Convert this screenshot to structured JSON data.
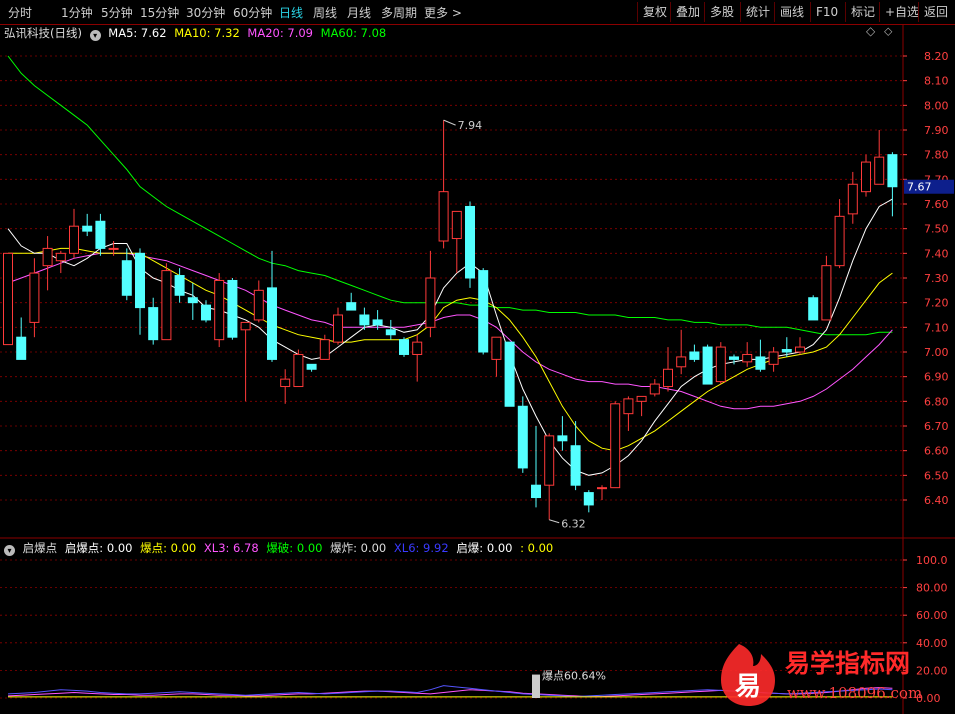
{
  "toolbar": {
    "periods": [
      "分时",
      "1分钟",
      "5分钟",
      "15分钟",
      "30分钟",
      "60分钟",
      "日线",
      "周线",
      "月线",
      "多周期",
      "更多"
    ],
    "active": "日线",
    "more_arrow": ">",
    "right_buttons": [
      "复权",
      "叠加",
      "多股",
      "统计",
      "画线",
      "F10",
      "标记",
      "+自选",
      "返回"
    ]
  },
  "main_info": {
    "stock": "弘讯科技(日线)",
    "ma5": "MA5: 7.62",
    "ma10": "MA10: 7.32",
    "ma20": "MA20: 7.09",
    "ma60": "MA60: 7.08",
    "diamond": "◇",
    "updown": "⬦"
  },
  "indicator_info": {
    "name": "启爆点",
    "qbd": "启爆点: 0.00",
    "bd": "爆点: 0.00",
    "xl3": "XL3: 6.78",
    "bp": "爆破: 0.00",
    "bz": "爆炸: 0.00",
    "xl6": "XL6: 9.92",
    "qb": "启爆: 0.00",
    "tail": ": 0.00"
  },
  "colors": {
    "up": "#ff3a3a",
    "down": "#54ffff",
    "ma5": "#ffffff",
    "ma10": "#ffff00",
    "ma20": "#ff55ff",
    "ma60": "#00ff00",
    "grid": "#8b0000",
    "axis_text": "#ff4040",
    "current_price_bg": "#0d1f8c"
  },
  "price_axis": {
    "labels": [
      "8.20",
      "8.10",
      "8.00",
      "7.90",
      "7.80",
      "7.70",
      "7.60",
      "7.50",
      "7.40",
      "7.30",
      "7.20",
      "7.10",
      "7.00",
      "6.90",
      "6.80",
      "6.70",
      "6.60",
      "6.50",
      "6.40"
    ],
    "current": "7.67"
  },
  "indicator_axis": {
    "labels": [
      "100.0",
      "80.00",
      "60.00",
      "40.00",
      "20.00",
      "0.00"
    ]
  },
  "annotations": {
    "high": "7.94",
    "low": "6.32",
    "burst": "爆点60.64%"
  },
  "watermark": {
    "icon_char": "易",
    "title": "易学指标网",
    "url": "www.108096.com"
  },
  "chart_data": {
    "type": "candlestick",
    "ylim": [
      6.27,
      8.28
    ],
    "candles": [
      {
        "o": 7.03,
        "h": 7.1,
        "l": 7.03,
        "c": 7.4
      },
      {
        "o": 7.06,
        "h": 7.14,
        "l": 6.97,
        "c": 6.97
      },
      {
        "o": 7.12,
        "h": 7.38,
        "l": 7.06,
        "c": 7.32
      },
      {
        "o": 7.35,
        "h": 7.47,
        "l": 7.25,
        "c": 7.42
      },
      {
        "o": 7.37,
        "h": 7.41,
        "l": 7.32,
        "c": 7.4
      },
      {
        "o": 7.4,
        "h": 7.58,
        "l": 7.38,
        "c": 7.51
      },
      {
        "o": 7.51,
        "h": 7.56,
        "l": 7.47,
        "c": 7.49
      },
      {
        "o": 7.53,
        "h": 7.56,
        "l": 7.39,
        "c": 7.42
      },
      {
        "o": 7.42,
        "h": 7.45,
        "l": 7.39,
        "c": 7.42
      },
      {
        "o": 7.37,
        "h": 7.42,
        "l": 7.21,
        "c": 7.23
      },
      {
        "o": 7.4,
        "h": 7.42,
        "l": 7.07,
        "c": 7.18
      },
      {
        "o": 7.18,
        "h": 7.22,
        "l": 7.03,
        "c": 7.05
      },
      {
        "o": 7.05,
        "h": 7.36,
        "l": 7.05,
        "c": 7.33
      },
      {
        "o": 7.31,
        "h": 7.34,
        "l": 7.2,
        "c": 7.23
      },
      {
        "o": 7.22,
        "h": 7.28,
        "l": 7.13,
        "c": 7.2
      },
      {
        "o": 7.19,
        "h": 7.21,
        "l": 7.12,
        "c": 7.13
      },
      {
        "o": 7.05,
        "h": 7.32,
        "l": 7.02,
        "c": 7.29
      },
      {
        "o": 7.29,
        "h": 7.3,
        "l": 7.05,
        "c": 7.06
      },
      {
        "o": 7.09,
        "h": 7.12,
        "l": 6.8,
        "c": 7.12
      },
      {
        "o": 7.13,
        "h": 7.29,
        "l": 7.12,
        "c": 7.25
      },
      {
        "o": 7.26,
        "h": 7.41,
        "l": 6.96,
        "c": 6.97
      },
      {
        "o": 6.86,
        "h": 6.93,
        "l": 6.79,
        "c": 6.89
      },
      {
        "o": 6.86,
        "h": 7.01,
        "l": 6.86,
        "c": 6.99
      },
      {
        "o": 6.95,
        "h": 6.95,
        "l": 6.92,
        "c": 6.93
      },
      {
        "o": 6.97,
        "h": 7.07,
        "l": 6.97,
        "c": 7.05
      },
      {
        "o": 7.04,
        "h": 7.18,
        "l": 7.03,
        "c": 7.15
      },
      {
        "o": 7.2,
        "h": 7.24,
        "l": 7.17,
        "c": 7.17
      },
      {
        "o": 7.15,
        "h": 7.18,
        "l": 7.09,
        "c": 7.11
      },
      {
        "o": 7.13,
        "h": 7.17,
        "l": 7.09,
        "c": 7.11
      },
      {
        "o": 7.09,
        "h": 7.13,
        "l": 7.05,
        "c": 7.07
      },
      {
        "o": 7.05,
        "h": 7.06,
        "l": 6.98,
        "c": 6.99
      },
      {
        "o": 6.99,
        "h": 7.07,
        "l": 6.88,
        "c": 7.04
      },
      {
        "o": 7.1,
        "h": 7.41,
        "l": 7.06,
        "c": 7.3
      },
      {
        "o": 7.45,
        "h": 7.94,
        "l": 7.42,
        "c": 7.65
      },
      {
        "o": 7.46,
        "h": 7.53,
        "l": 7.32,
        "c": 7.57
      },
      {
        "o": 7.59,
        "h": 7.61,
        "l": 7.26,
        "c": 7.3
      },
      {
        "o": 7.33,
        "h": 7.34,
        "l": 6.99,
        "c": 7.0
      },
      {
        "o": 6.97,
        "h": 7.0,
        "l": 6.9,
        "c": 7.06
      },
      {
        "o": 7.04,
        "h": 7.04,
        "l": 6.78,
        "c": 6.78
      },
      {
        "o": 6.78,
        "h": 6.82,
        "l": 6.51,
        "c": 6.53
      },
      {
        "o": 6.46,
        "h": 6.7,
        "l": 6.37,
        "c": 6.41
      },
      {
        "o": 6.46,
        "h": 6.67,
        "l": 6.32,
        "c": 6.66
      },
      {
        "o": 6.66,
        "h": 6.74,
        "l": 6.6,
        "c": 6.64
      },
      {
        "o": 6.62,
        "h": 6.72,
        "l": 6.44,
        "c": 6.46
      },
      {
        "o": 6.43,
        "h": 6.44,
        "l": 6.35,
        "c": 6.38
      },
      {
        "o": 6.45,
        "h": 6.46,
        "l": 6.4,
        "c": 6.45
      },
      {
        "o": 6.45,
        "h": 6.8,
        "l": 6.45,
        "c": 6.79
      },
      {
        "o": 6.75,
        "h": 6.82,
        "l": 6.68,
        "c": 6.81
      },
      {
        "o": 6.8,
        "h": 6.82,
        "l": 6.74,
        "c": 6.82
      },
      {
        "o": 6.83,
        "h": 6.89,
        "l": 6.82,
        "c": 6.87
      },
      {
        "o": 6.86,
        "h": 7.02,
        "l": 6.84,
        "c": 6.93
      },
      {
        "o": 6.94,
        "h": 7.09,
        "l": 6.91,
        "c": 6.98
      },
      {
        "o": 7.0,
        "h": 7.03,
        "l": 6.96,
        "c": 6.97
      },
      {
        "o": 7.02,
        "h": 7.03,
        "l": 6.87,
        "c": 6.87
      },
      {
        "o": 6.88,
        "h": 7.04,
        "l": 6.87,
        "c": 7.02
      },
      {
        "o": 6.98,
        "h": 6.99,
        "l": 6.95,
        "c": 6.97
      },
      {
        "o": 6.96,
        "h": 7.04,
        "l": 6.94,
        "c": 6.99
      },
      {
        "o": 6.98,
        "h": 7.05,
        "l": 6.92,
        "c": 6.93
      },
      {
        "o": 6.95,
        "h": 7.02,
        "l": 6.92,
        "c": 7.0
      },
      {
        "o": 7.01,
        "h": 7.06,
        "l": 6.98,
        "c": 7.0
      },
      {
        "o": 7.0,
        "h": 7.06,
        "l": 6.99,
        "c": 7.02
      },
      {
        "o": 7.22,
        "h": 7.23,
        "l": 7.14,
        "c": 7.13
      },
      {
        "o": 7.13,
        "h": 7.39,
        "l": 7.13,
        "c": 7.35
      },
      {
        "o": 7.35,
        "h": 7.62,
        "l": 7.34,
        "c": 7.55
      },
      {
        "o": 7.56,
        "h": 7.73,
        "l": 7.52,
        "c": 7.68
      },
      {
        "o": 7.65,
        "h": 7.8,
        "l": 7.63,
        "c": 7.77
      },
      {
        "o": 7.68,
        "h": 7.9,
        "l": 7.68,
        "c": 7.79
      },
      {
        "o": 7.8,
        "h": 7.81,
        "l": 7.55,
        "c": 7.67
      }
    ],
    "ma5": [
      7.5,
      7.43,
      7.4,
      7.4,
      7.37,
      7.35,
      7.38,
      7.42,
      7.44,
      7.44,
      7.34,
      7.3,
      7.28,
      7.25,
      7.23,
      7.18,
      7.17,
      7.15,
      7.13,
      7.1,
      7.05,
      7.02,
      6.99,
      6.97,
      6.98,
      7.02,
      7.06,
      7.1,
      7.11,
      7.1,
      7.08,
      7.09,
      7.15,
      7.26,
      7.32,
      7.36,
      7.32,
      7.15,
      6.99,
      6.85,
      6.74,
      6.64,
      6.57,
      6.52,
      6.5,
      6.51,
      6.54,
      6.58,
      6.64,
      6.72,
      6.79,
      6.86,
      6.9,
      6.93,
      6.95,
      6.96,
      6.97,
      6.97,
      6.98,
      6.99,
      7.0,
      7.03,
      7.09,
      7.22,
      7.37,
      7.5,
      7.59,
      7.62
    ],
    "ma10": [
      7.4,
      7.4,
      7.4,
      7.41,
      7.42,
      7.42,
      7.41,
      7.4,
      7.4,
      7.4,
      7.4,
      7.37,
      7.34,
      7.31,
      7.28,
      7.25,
      7.23,
      7.2,
      7.17,
      7.14,
      7.11,
      7.09,
      7.07,
      7.06,
      7.05,
      7.04,
      7.04,
      7.05,
      7.05,
      7.05,
      7.05,
      7.07,
      7.11,
      7.18,
      7.21,
      7.22,
      7.21,
      7.18,
      7.13,
      7.06,
      6.98,
      6.88,
      6.78,
      6.7,
      6.64,
      6.61,
      6.6,
      6.62,
      6.65,
      6.68,
      6.72,
      6.76,
      6.8,
      6.84,
      6.87,
      6.9,
      6.93,
      6.95,
      6.97,
      6.98,
      6.99,
      7.0,
      7.02,
      7.07,
      7.14,
      7.21,
      7.28,
      7.32
    ],
    "ma20": [
      7.28,
      7.3,
      7.32,
      7.34,
      7.36,
      7.38,
      7.39,
      7.4,
      7.4,
      7.4,
      7.39,
      7.38,
      7.37,
      7.35,
      7.33,
      7.31,
      7.29,
      7.27,
      7.25,
      7.22,
      7.19,
      7.17,
      7.15,
      7.13,
      7.12,
      7.1,
      7.1,
      7.1,
      7.1,
      7.1,
      7.1,
      7.11,
      7.12,
      7.14,
      7.15,
      7.15,
      7.13,
      7.1,
      7.05,
      7.0,
      6.96,
      6.93,
      6.91,
      6.89,
      6.88,
      6.88,
      6.87,
      6.87,
      6.86,
      6.86,
      6.85,
      6.84,
      6.82,
      6.8,
      6.78,
      6.77,
      6.77,
      6.78,
      6.78,
      6.79,
      6.8,
      6.82,
      6.85,
      6.89,
      6.93,
      6.98,
      7.03,
      7.09
    ],
    "ma60": [
      8.2,
      8.13,
      8.08,
      8.04,
      8.0,
      7.96,
      7.92,
      7.86,
      7.8,
      7.74,
      7.67,
      7.63,
      7.59,
      7.56,
      7.53,
      7.5,
      7.47,
      7.44,
      7.41,
      7.38,
      7.36,
      7.35,
      7.33,
      7.32,
      7.31,
      7.29,
      7.27,
      7.25,
      7.23,
      7.21,
      7.2,
      7.2,
      7.2,
      7.2,
      7.2,
      7.19,
      7.19,
      7.18,
      7.18,
      7.17,
      7.17,
      7.16,
      7.16,
      7.16,
      7.15,
      7.15,
      7.15,
      7.14,
      7.14,
      7.14,
      7.13,
      7.13,
      7.12,
      7.12,
      7.11,
      7.11,
      7.11,
      7.1,
      7.1,
      7.1,
      7.09,
      7.08,
      7.07,
      7.07,
      7.07,
      7.07,
      7.08,
      7.08
    ],
    "indicator": {
      "ylim": [
        0,
        110
      ],
      "burst_bar_index": 40,
      "burst_value": 60.64,
      "lines": [
        {
          "color": "#ff55ff",
          "values": [
            1.5,
            2,
            2.5,
            3,
            3.5,
            4,
            3.5,
            3,
            2.5,
            2.5,
            2,
            2,
            2.5,
            3,
            3,
            2.5,
            2,
            2,
            1.5,
            1.5,
            2,
            2.5,
            3,
            3,
            3.5,
            4,
            4.5,
            5,
            5,
            4.5,
            4,
            3.5,
            3,
            4,
            5,
            6,
            5.5,
            5,
            4.5,
            3.5,
            3,
            2.5,
            2,
            1.5,
            1,
            1,
            1.5,
            2,
            2.5,
            3,
            3.5,
            4,
            4.5,
            5,
            5.5,
            5,
            4.5,
            4,
            3.5,
            3,
            3,
            3.5,
            4,
            5,
            6,
            7,
            7.5,
            7
          ]
        },
        {
          "color": "#5555ff",
          "values": [
            3,
            3.5,
            4,
            5,
            6,
            5.5,
            5,
            4,
            3.5,
            3,
            3,
            3.5,
            4,
            4.5,
            4,
            3.5,
            3,
            2.5,
            2,
            2.5,
            3,
            3.5,
            4,
            3.5,
            3,
            3.5,
            4,
            4.5,
            5,
            5,
            4.5,
            4,
            6,
            9,
            8,
            7,
            6,
            5,
            4,
            3,
            2.5,
            2,
            1.5,
            1,
            1.5,
            2,
            2.5,
            3,
            3.5,
            4,
            4.5,
            5,
            5.5,
            6,
            5.5,
            5,
            4.5,
            4,
            3.5,
            3,
            3.5,
            4,
            4.5,
            5,
            5.5,
            6,
            6.5,
            6
          ]
        },
        {
          "color": "#ffff00",
          "values": [
            0.8,
            0.8,
            0.8,
            0.8,
            0.8,
            0.8,
            0.8,
            0.8,
            0.8,
            0.8,
            0.8,
            0.8,
            0.8,
            0.8,
            0.8,
            0.8,
            0.8,
            0.8,
            0.8,
            0.8,
            0.8,
            0.8,
            0.8,
            0.8,
            0.8,
            0.8,
            0.8,
            0.8,
            0.8,
            0.8,
            0.8,
            0.8,
            0.8,
            0.8,
            0.8,
            0.8,
            0.8,
            0.8,
            0.8,
            0.8,
            0.8,
            0.8,
            0.8,
            0.8,
            0.8,
            0.8,
            0.8,
            0.8,
            0.8,
            0.8,
            0.8,
            0.8,
            0.8,
            0.8,
            0.8,
            0.8,
            0.8,
            0.8,
            0.8,
            0.8,
            0.8,
            0.8,
            0.8,
            0.8,
            0.8,
            0.8,
            0.8,
            0.8
          ]
        }
      ]
    }
  }
}
